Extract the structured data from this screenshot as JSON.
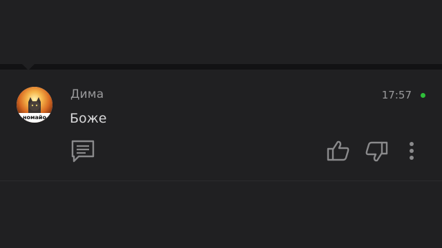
{
  "comment": {
    "author": "Дима",
    "time": "17:57",
    "text": "Боже",
    "avatar_caption": "номайо",
    "online_color": "#2fbf3a"
  },
  "icons": {
    "reply": "comment-icon",
    "like": "thumbs-up-icon",
    "dislike": "thumbs-down-icon",
    "more": "more-vertical-icon"
  }
}
